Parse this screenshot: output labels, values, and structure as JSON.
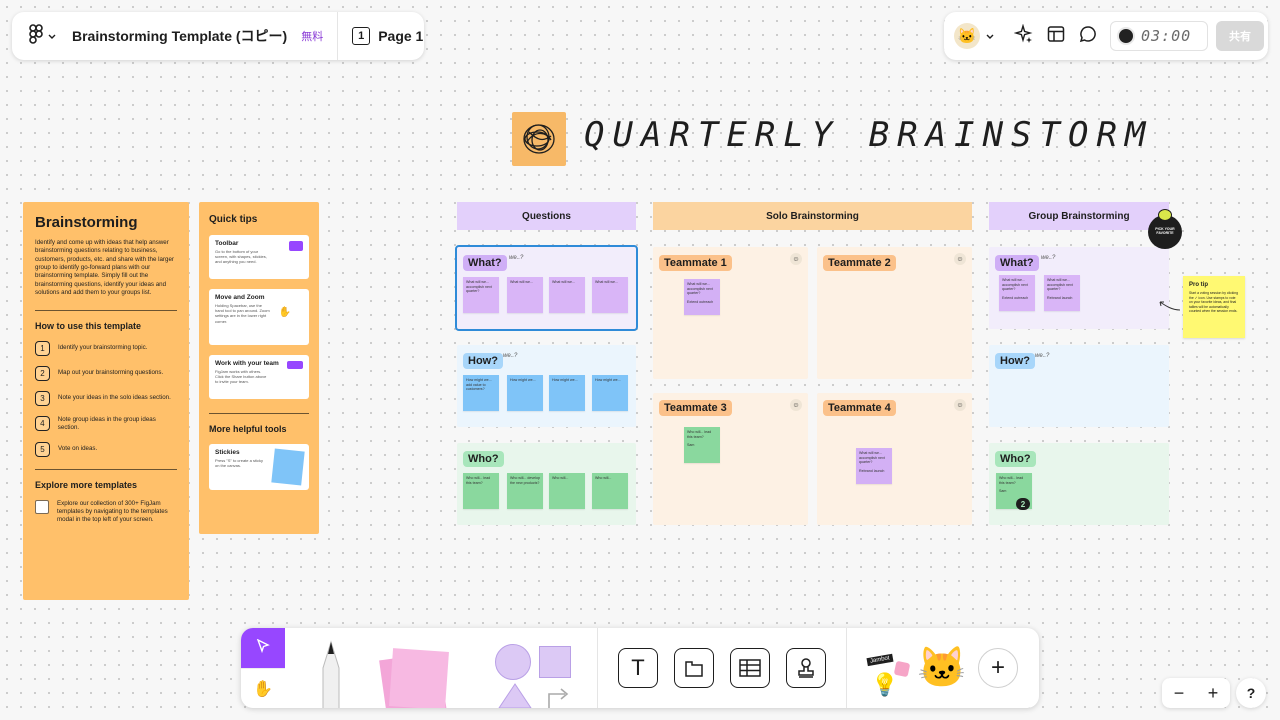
{
  "topbar": {
    "file_title": "Brainstorming Template (コピー)",
    "plan_badge": "無料",
    "page_label": "Page 1",
    "page_number": "1",
    "timer": "03:00",
    "share_label": "共有",
    "icons": [
      "figjam-menu-icon",
      "chevron-down-icon",
      "avatar-cat-icon",
      "sparkle-ai-icon",
      "layout-icon",
      "comment-icon",
      "timer-icon"
    ]
  },
  "heading": {
    "title": "QUARTERLY BRAINSTORM"
  },
  "brainstorming_panel": {
    "title": "Brainstorming",
    "description": "Identify and come up with ideas that help answer brainstorming questions relating to business, customers, products, etc. and share with the larger group to identify go-forward plans with our brainstorming template. Simply fill out the brainstorming questions, identify your ideas and solutions and add them to your groups list.",
    "how_to_title": "How to use this template",
    "steps": [
      {
        "icon": "1",
        "text": "Identify your brainstorming topic."
      },
      {
        "icon": "2",
        "text": "Map out your brainstorming questions."
      },
      {
        "icon": "3",
        "text": "Note your ideas in the solo ideas section."
      },
      {
        "icon": "4",
        "text": "Note group ideas in the group ideas section."
      },
      {
        "icon": "5",
        "text": "Vote on ideas."
      }
    ],
    "explore_title": "Explore more templates",
    "explore_text": "Explore our collection of 300+ FigJam templates by navigating to the templates modal in the top left of your screen."
  },
  "tips_panel": {
    "title": "Quick tips",
    "cards": [
      {
        "title": "Toolbar",
        "text": "Go to the bottom of your screen, with shapes, stickies, and anything you need."
      },
      {
        "title": "Move and Zoom",
        "text": "Holding Spacebar, use the hand tool to pan around. Zoom settings are in the lower right corner."
      },
      {
        "title": "Work with your team",
        "text": "FigJam works with others. Click the Share button above to invite your team."
      }
    ],
    "more_title": "More helpful tools",
    "stickies_card": {
      "title": "Stickies",
      "text": "Press \"S\" to create a sticky on the canvas."
    }
  },
  "sections": {
    "questions": "Questions",
    "solo": "Solo Brainstorming",
    "group": "Group Brainstorming"
  },
  "questions_boards": [
    {
      "tag": "What?",
      "tail": "we..?",
      "stickies": [
        "What will we... accomplish next quarter?",
        "What will we...",
        "What will we...",
        "What will we..."
      ]
    },
    {
      "tag": "How?",
      "tail": "we..?",
      "stickies": [
        "How might we... add value to customers?",
        "How might we...",
        "How might we...",
        "How might we..."
      ]
    },
    {
      "tag": "Who?",
      "tail": "",
      "stickies": [
        "Who will... lead this team?",
        "Who will... develop the new products?",
        "Who will...",
        "Who will..."
      ]
    }
  ],
  "solo_boards": [
    {
      "tag": "Teammate 1",
      "sticky": "What will we... accomplish next quarter?",
      "sticky_sub": "Extend outreach"
    },
    {
      "tag": "Teammate 2",
      "sticky": "",
      "sticky_sub": ""
    },
    {
      "tag": "Teammate 3",
      "sticky": "Who will... lead this team?",
      "sticky_sub": "Sam"
    },
    {
      "tag": "Teammate 4",
      "sticky": "What will we... accomplish next quarter?",
      "sticky_sub": "Rebrand launch"
    }
  ],
  "group_boards": [
    {
      "tag": "What?",
      "tail": "we..?",
      "stickies": [
        {
          "text": "What will we... accomplish next quarter?",
          "sub": "Extend outreach"
        },
        {
          "text": "What will we... accomplish next quarter?",
          "sub": "Rebrand launch"
        }
      ]
    },
    {
      "tag": "How?",
      "tail": "we..?",
      "stickies": []
    },
    {
      "tag": "Who?",
      "tail": "",
      "stickies": [
        {
          "text": "Who will... lead this team?",
          "sub": "Sam"
        }
      ]
    }
  ],
  "vote_badge": "PICK YOUR FAVORITE",
  "vote_count": "2",
  "protip": {
    "title": "Pro tip",
    "text": "Start a voting session by clicking the ✓ icon. Use stamps to vote on your favorite ideas, and final tallies will be automatically counted when the session ends."
  },
  "toolbar": {
    "tools": [
      "select-tool",
      "hand-tool",
      "marker-tool",
      "sticky-tool",
      "shape-tool",
      "text-tool",
      "section-tool",
      "table-tool",
      "stamp-tool",
      "stickers-tool",
      "add-tool"
    ],
    "stickers_label": "Jambot",
    "add_label": "+"
  },
  "zoom": {
    "minus": "−",
    "plus": "+"
  },
  "help": "?",
  "colors": {
    "accent": "#9747ff",
    "orange_panel": "#ffc06a",
    "purple_header": "#e3d0fb",
    "orange_header": "#fbd4a0",
    "selection": "#2f8bd8",
    "yellow_sticky": "#fff972"
  }
}
